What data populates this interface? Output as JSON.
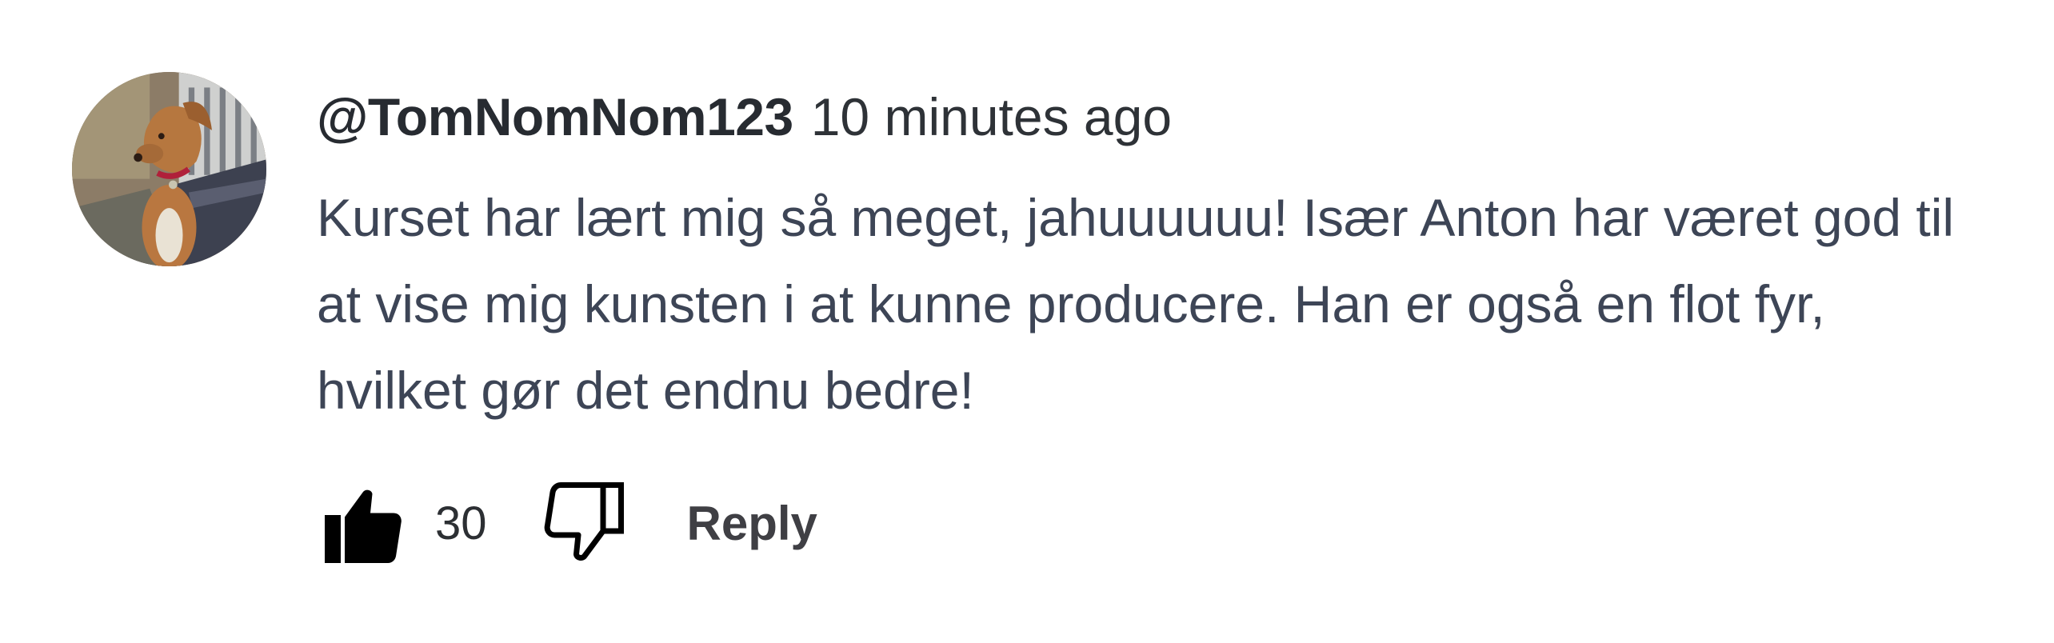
{
  "comment": {
    "username": "@TomNomNom123",
    "timestamp": "10 minutes ago",
    "text": "Kurset har lært mig så meget, jahuuuuuu! Især Anton har været god til at vise mig kunsten i at kunne producere. Han er også en flot fyr, hvilket gør det endnu bedre!",
    "avatar_icon": "dog-photo-avatar"
  },
  "actions": {
    "like_icon": "thumbs-up-icon",
    "like_count": "30",
    "dislike_icon": "thumbs-down-icon",
    "reply_label": "Reply"
  },
  "colors": {
    "username": "#272b31",
    "text": "#3d4556",
    "reply": "#3f3f44"
  }
}
